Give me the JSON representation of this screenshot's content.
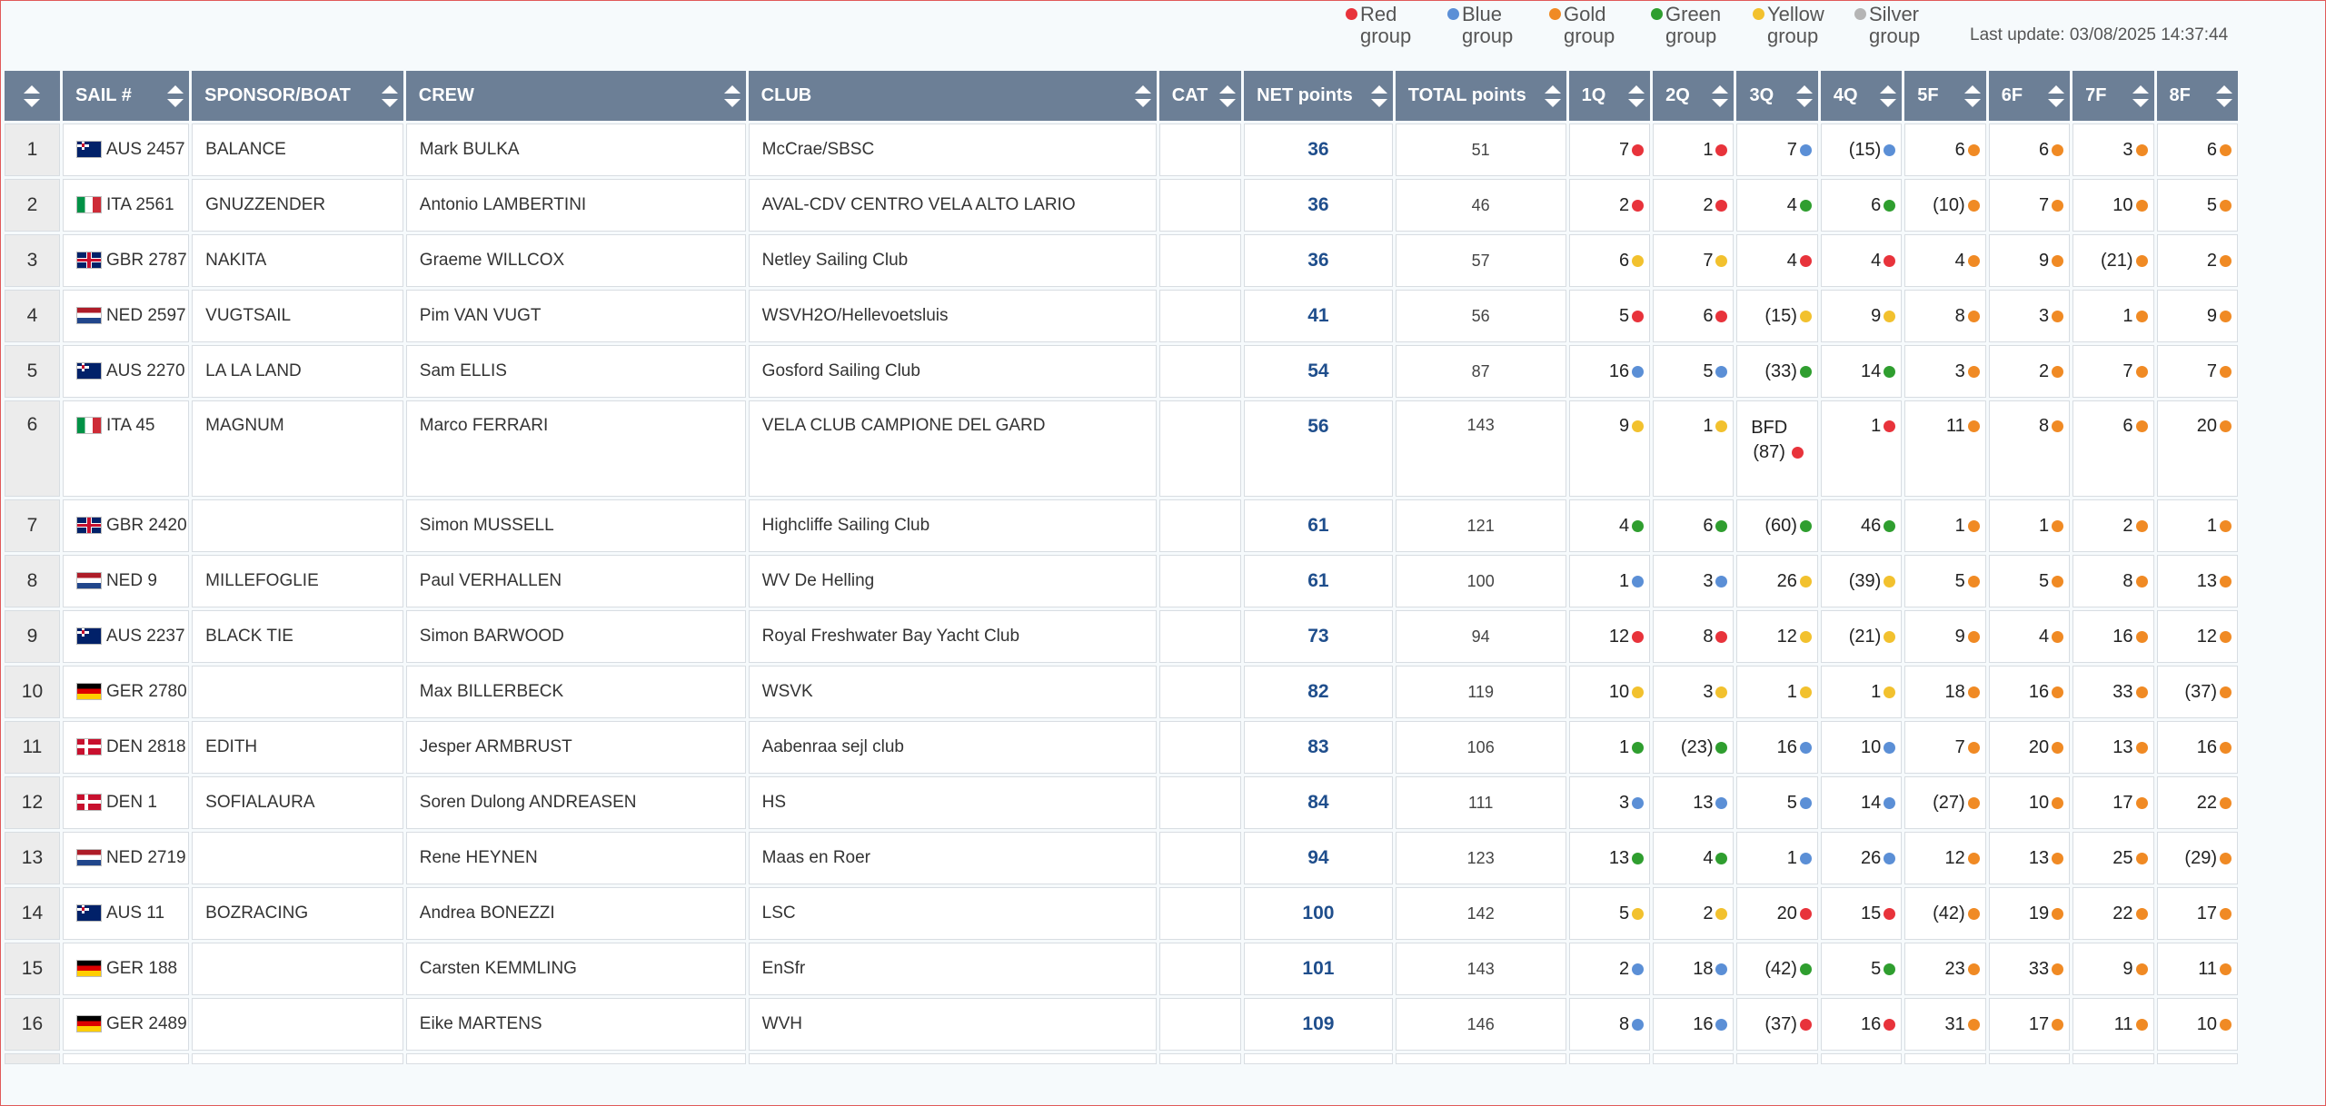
{
  "legend": [
    {
      "line1": "Red",
      "line2": "group",
      "color": "#e8333b"
    },
    {
      "line1": "Blue",
      "line2": "group",
      "color": "#5b8fd6"
    },
    {
      "line1": "Gold",
      "line2": "group",
      "color": "#f08a24"
    },
    {
      "line1": "Green",
      "line2": "group",
      "color": "#2f9e2f"
    },
    {
      "line1": "Yellow",
      "line2": "group",
      "color": "#f2c12e"
    },
    {
      "line1": "Silver",
      "line2": "group",
      "color": "#b5b5b5"
    }
  ],
  "last_update": "Last update: 03/08/2025 14:37:44",
  "colors": {
    "red": "#e8333b",
    "blue": "#5b8fd6",
    "gold": "#f08a24",
    "green": "#2f9e2f",
    "yellow": "#f2c12e",
    "silver": "#b5b5b5"
  },
  "table": {
    "columns": [
      "",
      "SAIL #",
      "SPONSOR/BOAT",
      "CREW",
      "CLUB",
      "CAT",
      "NET points",
      "TOTAL points",
      "1Q",
      "2Q",
      "3Q",
      "4Q",
      "5F",
      "6F",
      "7F",
      "8F"
    ],
    "rows": [
      {
        "rank": "1",
        "flag": "AUS",
        "sail": "AUS 2457",
        "sponsor": "BALANCE",
        "crew": "Mark BULKA",
        "club": "McCrae/SBSC",
        "cat": "",
        "net": "36",
        "total": "51",
        "races": [
          [
            "7",
            "red"
          ],
          [
            "1",
            "red"
          ],
          [
            "7",
            "blue"
          ],
          [
            "(15)",
            "blue"
          ],
          [
            "6",
            "gold"
          ],
          [
            "6",
            "gold"
          ],
          [
            "3",
            "gold"
          ],
          [
            "6",
            "gold"
          ]
        ]
      },
      {
        "rank": "2",
        "flag": "ITA",
        "sail": "ITA 2561",
        "sponsor": "GNUZZENDER",
        "crew": "Antonio LAMBERTINI",
        "club": "AVAL-CDV CENTRO VELA ALTO LARIO",
        "cat": "",
        "net": "36",
        "total": "46",
        "races": [
          [
            "2",
            "red"
          ],
          [
            "2",
            "red"
          ],
          [
            "4",
            "green"
          ],
          [
            "6",
            "green"
          ],
          [
            "(10)",
            "gold"
          ],
          [
            "7",
            "gold"
          ],
          [
            "10",
            "gold"
          ],
          [
            "5",
            "gold"
          ]
        ]
      },
      {
        "rank": "3",
        "flag": "GBR",
        "sail": "GBR 2787",
        "sponsor": "NAKITA",
        "crew": "Graeme WILLCOX",
        "club": "Netley Sailing Club",
        "cat": "",
        "net": "36",
        "total": "57",
        "races": [
          [
            "6",
            "yellow"
          ],
          [
            "7",
            "yellow"
          ],
          [
            "4",
            "red"
          ],
          [
            "4",
            "red"
          ],
          [
            "4",
            "gold"
          ],
          [
            "9",
            "gold"
          ],
          [
            "(21)",
            "gold"
          ],
          [
            "2",
            "gold"
          ]
        ]
      },
      {
        "rank": "4",
        "flag": "NED",
        "sail": "NED 2597",
        "sponsor": "VUGTSAIL",
        "crew": "Pim VAN VUGT",
        "club": "WSVH2O/Hellevoetsluis",
        "cat": "",
        "net": "41",
        "total": "56",
        "races": [
          [
            "5",
            "red"
          ],
          [
            "6",
            "red"
          ],
          [
            "(15)",
            "yellow"
          ],
          [
            "9",
            "yellow"
          ],
          [
            "8",
            "gold"
          ],
          [
            "3",
            "gold"
          ],
          [
            "1",
            "gold"
          ],
          [
            "9",
            "gold"
          ]
        ]
      },
      {
        "rank": "5",
        "flag": "AUS",
        "sail": "AUS 2270",
        "sponsor": "LA LA LAND",
        "crew": "Sam ELLIS",
        "club": "Gosford Sailing Club",
        "cat": "",
        "net": "54",
        "total": "87",
        "races": [
          [
            "16",
            "blue"
          ],
          [
            "5",
            "blue"
          ],
          [
            "(33)",
            "green"
          ],
          [
            "14",
            "green"
          ],
          [
            "3",
            "gold"
          ],
          [
            "2",
            "gold"
          ],
          [
            "7",
            "gold"
          ],
          [
            "7",
            "gold"
          ]
        ]
      },
      {
        "rank": "6",
        "flag": "ITA",
        "sail": "ITA 45",
        "sponsor": "MAGNUM",
        "crew": "Marco FERRARI",
        "club": "VELA CLUB CAMPIONE DEL GARD",
        "cat": "",
        "net": "56",
        "total": "143",
        "tall": true,
        "races": [
          [
            "9",
            "yellow"
          ],
          [
            "1",
            "yellow"
          ],
          [
            "BFD (87)",
            "red"
          ],
          [
            "1",
            "red"
          ],
          [
            "11",
            "gold"
          ],
          [
            "8",
            "gold"
          ],
          [
            "6",
            "gold"
          ],
          [
            "20",
            "gold"
          ]
        ]
      },
      {
        "rank": "7",
        "flag": "GBR",
        "sail": "GBR 2420",
        "sponsor": "",
        "crew": "Simon MUSSELL",
        "club": "Highcliffe Sailing Club",
        "cat": "",
        "net": "61",
        "total": "121",
        "races": [
          [
            "4",
            "green"
          ],
          [
            "6",
            "green"
          ],
          [
            "(60)",
            "green"
          ],
          [
            "46",
            "green"
          ],
          [
            "1",
            "gold"
          ],
          [
            "1",
            "gold"
          ],
          [
            "2",
            "gold"
          ],
          [
            "1",
            "gold"
          ]
        ]
      },
      {
        "rank": "8",
        "flag": "NED",
        "sail": "NED 9",
        "sponsor": "MILLEFOGLIE",
        "crew": "Paul VERHALLEN",
        "club": "WV De Helling",
        "cat": "",
        "net": "61",
        "total": "100",
        "races": [
          [
            "1",
            "blue"
          ],
          [
            "3",
            "blue"
          ],
          [
            "26",
            "yellow"
          ],
          [
            "(39)",
            "yellow"
          ],
          [
            "5",
            "gold"
          ],
          [
            "5",
            "gold"
          ],
          [
            "8",
            "gold"
          ],
          [
            "13",
            "gold"
          ]
        ]
      },
      {
        "rank": "9",
        "flag": "AUS",
        "sail": "AUS 2237",
        "sponsor": "BLACK TIE",
        "crew": "Simon BARWOOD",
        "club": "Royal Freshwater Bay Yacht Club",
        "cat": "",
        "net": "73",
        "total": "94",
        "races": [
          [
            "12",
            "red"
          ],
          [
            "8",
            "red"
          ],
          [
            "12",
            "yellow"
          ],
          [
            "(21)",
            "yellow"
          ],
          [
            "9",
            "gold"
          ],
          [
            "4",
            "gold"
          ],
          [
            "16",
            "gold"
          ],
          [
            "12",
            "gold"
          ]
        ]
      },
      {
        "rank": "10",
        "flag": "GER",
        "sail": "GER 2780",
        "sponsor": "",
        "crew": "Max BILLERBECK",
        "club": "WSVK",
        "cat": "",
        "net": "82",
        "total": "119",
        "races": [
          [
            "10",
            "yellow"
          ],
          [
            "3",
            "yellow"
          ],
          [
            "1",
            "yellow"
          ],
          [
            "1",
            "yellow"
          ],
          [
            "18",
            "gold"
          ],
          [
            "16",
            "gold"
          ],
          [
            "33",
            "gold"
          ],
          [
            "(37)",
            "gold"
          ]
        ]
      },
      {
        "rank": "11",
        "flag": "DEN",
        "sail": "DEN 2818",
        "sponsor": "EDITH",
        "crew": "Jesper ARMBRUST",
        "club": "Aabenraa sejl club",
        "cat": "",
        "net": "83",
        "total": "106",
        "races": [
          [
            "1",
            "green"
          ],
          [
            "(23)",
            "green"
          ],
          [
            "16",
            "blue"
          ],
          [
            "10",
            "blue"
          ],
          [
            "7",
            "gold"
          ],
          [
            "20",
            "gold"
          ],
          [
            "13",
            "gold"
          ],
          [
            "16",
            "gold"
          ]
        ]
      },
      {
        "rank": "12",
        "flag": "DEN",
        "sail": "DEN 1",
        "sponsor": "SOFIALAURA",
        "crew": "Soren Dulong ANDREASEN",
        "club": "HS",
        "cat": "",
        "net": "84",
        "total": "111",
        "races": [
          [
            "3",
            "blue"
          ],
          [
            "13",
            "blue"
          ],
          [
            "5",
            "blue"
          ],
          [
            "14",
            "blue"
          ],
          [
            "(27)",
            "gold"
          ],
          [
            "10",
            "gold"
          ],
          [
            "17",
            "gold"
          ],
          [
            "22",
            "gold"
          ]
        ]
      },
      {
        "rank": "13",
        "flag": "NED",
        "sail": "NED 2719",
        "sponsor": "",
        "crew": "Rene HEYNEN",
        "club": "Maas en Roer",
        "cat": "",
        "net": "94",
        "total": "123",
        "races": [
          [
            "13",
            "green"
          ],
          [
            "4",
            "green"
          ],
          [
            "1",
            "blue"
          ],
          [
            "26",
            "blue"
          ],
          [
            "12",
            "gold"
          ],
          [
            "13",
            "gold"
          ],
          [
            "25",
            "gold"
          ],
          [
            "(29)",
            "gold"
          ]
        ]
      },
      {
        "rank": "14",
        "flag": "AUS",
        "sail": "AUS 11",
        "sponsor": "BOZRACING",
        "crew": "Andrea BONEZZI",
        "club": "LSC",
        "cat": "",
        "net": "100",
        "total": "142",
        "races": [
          [
            "5",
            "yellow"
          ],
          [
            "2",
            "yellow"
          ],
          [
            "20",
            "red"
          ],
          [
            "15",
            "red"
          ],
          [
            "(42)",
            "gold"
          ],
          [
            "19",
            "gold"
          ],
          [
            "22",
            "gold"
          ],
          [
            "17",
            "gold"
          ]
        ]
      },
      {
        "rank": "15",
        "flag": "GER",
        "sail": "GER 188",
        "sponsor": "",
        "crew": "Carsten KEMMLING",
        "club": "EnSfr",
        "cat": "",
        "net": "101",
        "total": "143",
        "races": [
          [
            "2",
            "blue"
          ],
          [
            "18",
            "blue"
          ],
          [
            "(42)",
            "green"
          ],
          [
            "5",
            "green"
          ],
          [
            "23",
            "gold"
          ],
          [
            "33",
            "gold"
          ],
          [
            "9",
            "gold"
          ],
          [
            "11",
            "gold"
          ]
        ]
      },
      {
        "rank": "16",
        "flag": "GER",
        "sail": "GER 2489",
        "sponsor": "",
        "crew": "Eike MARTENS",
        "club": "WVH",
        "cat": "",
        "net": "109",
        "total": "146",
        "races": [
          [
            "8",
            "blue"
          ],
          [
            "16",
            "blue"
          ],
          [
            "(37)",
            "red"
          ],
          [
            "16",
            "red"
          ],
          [
            "31",
            "gold"
          ],
          [
            "17",
            "gold"
          ],
          [
            "11",
            "gold"
          ],
          [
            "10",
            "gold"
          ]
        ]
      }
    ]
  }
}
